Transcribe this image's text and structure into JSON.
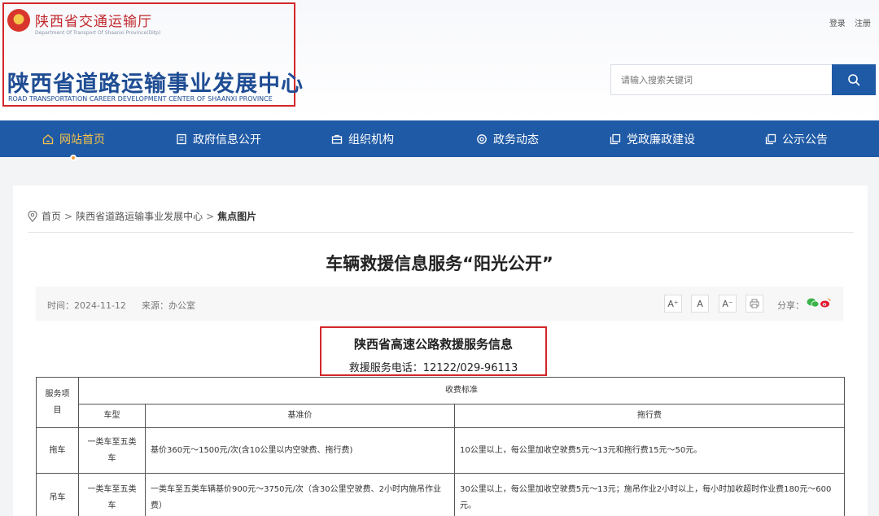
{
  "header": {
    "dept_name": "陕西省交通运输厅",
    "dept_en": "Department Of Transport Of Shaanxi Province(Ditp)",
    "center_name": "陕西省道路运输事业发展中心",
    "center_en": "ROAD TRANSPORTATION CAREER DEVELOPMENT CENTER OF SHAANXI PROVINCE",
    "login": "登录",
    "register": "注册",
    "search_placeholder": "请输入搜索关键词"
  },
  "nav": {
    "items": [
      {
        "label": "网站首页",
        "icon": "home-icon"
      },
      {
        "label": "政府信息公开",
        "icon": "document-icon"
      },
      {
        "label": "组织机构",
        "icon": "briefcase-icon"
      },
      {
        "label": "政务动态",
        "icon": "gear-icon"
      },
      {
        "label": "党政廉政建设",
        "icon": "copy-icon"
      },
      {
        "label": "公示公告",
        "icon": "copy-icon"
      }
    ]
  },
  "breadcrumb": {
    "home": "首页",
    "sep": ">",
    "level1": "陕西省道路运输事业发展中心",
    "current": "焦点图片"
  },
  "article": {
    "title": "车辆救援信息服务“阳光公开”",
    "time": "时间：2024-11-12",
    "source": "来源：办公室",
    "share_label": "分享：",
    "font_buttons": [
      "A⁺",
      "A",
      "A⁻"
    ]
  },
  "info": {
    "title": "陕西省高速公路救援服务信息",
    "phone": "救援服务电话：12122/029-96113"
  },
  "table": {
    "col_service": "服务项目",
    "col_fee": "收费标准",
    "col_vehicle": "车型",
    "col_base": "基准价",
    "col_tow": "拖行费",
    "rows": [
      {
        "service": "拖车",
        "vehicle": "一类车至五类车",
        "base": "基价360元～1500元/次(含10公里以内空驶费、拖行费)",
        "tow": "10公里以上，每公里加收空驶费5元～13元和拖行费15元～50元。"
      },
      {
        "service": "吊车",
        "vehicle": "一类车至五类车",
        "base": "一类车至五类车辆基价900元～3750元/次（含30公里空驶费、2小时内施吊作业费）",
        "tow": "30公里以上，每公里加收空驶费5元～13元；施吊作业2小时以上，每小时加收超时作业费180元～600元。"
      }
    ]
  },
  "colors": {
    "nav_bg": "#1f5aa6",
    "nav_active": "#f6c24b",
    "highlight_border": "#d3272b",
    "brand_blue": "#1f4d94"
  }
}
